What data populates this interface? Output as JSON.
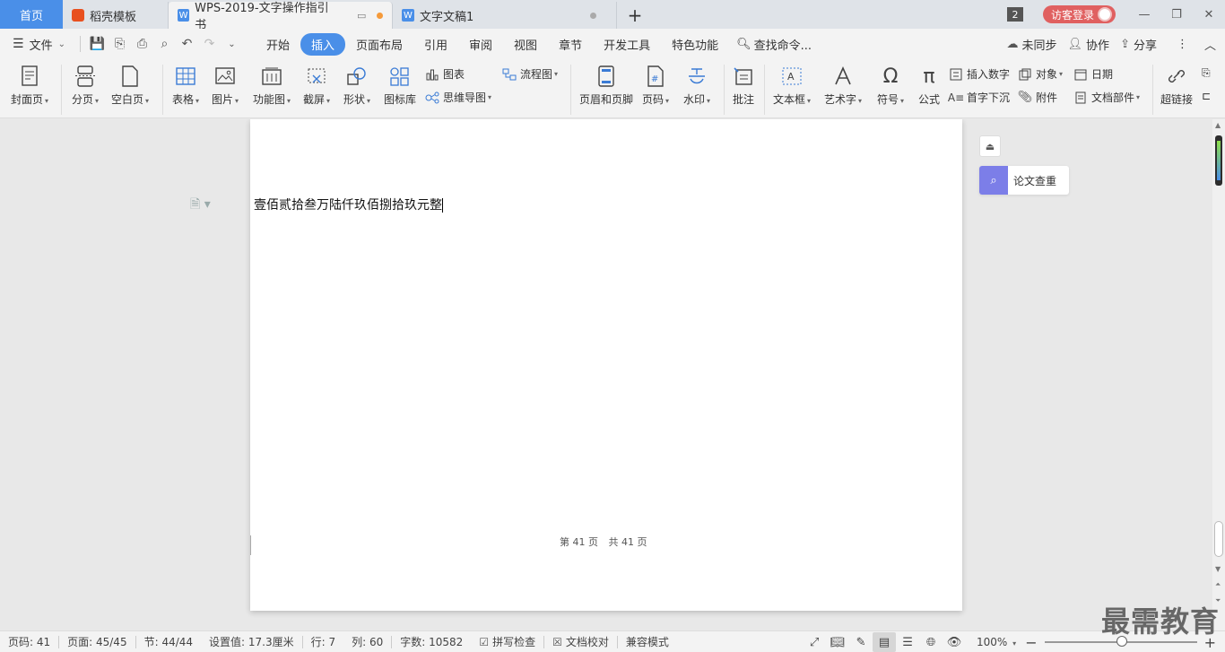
{
  "tabs": {
    "home": "首页",
    "template": "稻壳模板",
    "doc1": "WPS-2019-文字操作指引书",
    "doc2": "文字文稿1",
    "add": "+"
  },
  "titlebar": {
    "badge": "2",
    "login": "访客登录"
  },
  "menu": {
    "file": "文件",
    "items": [
      "开始",
      "插入",
      "页面布局",
      "引用",
      "审阅",
      "视图",
      "章节",
      "开发工具",
      "特色功能"
    ],
    "active": "插入",
    "search": "查找命令...",
    "sync": "未同步",
    "collab": "协作",
    "share": "分享"
  },
  "ribbon": {
    "cover": "封面页",
    "pagebreak": "分页",
    "blankpage": "空白页",
    "table": "表格",
    "picture": "图片",
    "funcchart": "功能图",
    "screenshot": "截屏",
    "shape": "形状",
    "iconlib": "图标库",
    "chart": "图表",
    "mindmap": "思维导图",
    "flowchart": "流程图",
    "headerfooter": "页眉和页脚",
    "pagenum": "页码",
    "watermark": "水印",
    "comment": "批注",
    "textbox": "文本框",
    "wordart": "艺术字",
    "symbol": "符号",
    "formula": "公式",
    "insertnum": "插入数字",
    "dropcap": "首字下沉",
    "object": "对象",
    "attachment": "附件",
    "date": "日期",
    "docparts": "文档部件",
    "hyperlink": "超链接"
  },
  "document": {
    "text": "壹佰贰拾叁万陆仟玖佰捌拾玖元整",
    "footer_a": "第",
    "footer_page": "41",
    "footer_b": "页",
    "footer_c": "共",
    "footer_total": "41",
    "footer_d": "页"
  },
  "sidepanel": {
    "paper_check": "论文查重"
  },
  "statusbar": {
    "pagecode": "页码: 41",
    "page": "页面: 45/45",
    "section": "节: 44/44",
    "setting": "设置值: 17.3厘米",
    "row": "行: 7",
    "col": "列: 60",
    "wordcount": "字数: 10582",
    "spellcheck": "拼写检查",
    "proofread": "文档校对",
    "compat": "兼容模式",
    "zoom": "100%"
  },
  "watermark_text": "最需教育"
}
